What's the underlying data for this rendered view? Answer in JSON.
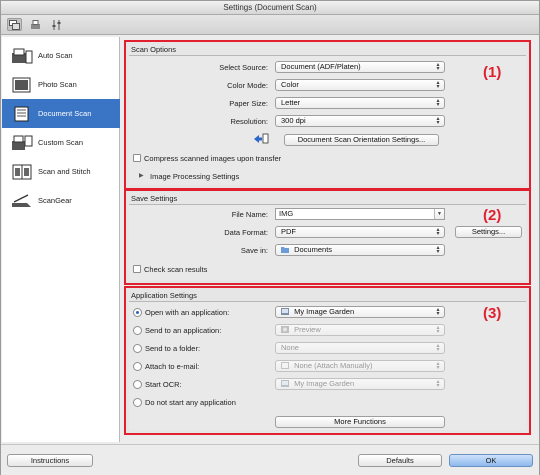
{
  "window": {
    "title": "Settings (Document Scan)"
  },
  "toolbar": {
    "icons": [
      "scan-from-computer-icon",
      "scan-from-panel-icon",
      "general-settings-icon"
    ]
  },
  "sidebar": {
    "items": [
      {
        "label": "Auto Scan",
        "icon": "auto-scan-icon"
      },
      {
        "label": "Photo Scan",
        "icon": "photo-scan-icon"
      },
      {
        "label": "Document Scan",
        "icon": "document-scan-icon",
        "active": true
      },
      {
        "label": "Custom Scan",
        "icon": "custom-scan-icon"
      },
      {
        "label": "Scan and Stitch",
        "icon": "scan-and-stitch-icon"
      },
      {
        "label": "ScanGear",
        "icon": "scangear-icon"
      }
    ]
  },
  "scan_options": {
    "title": "Scan Options",
    "marker": "(1)",
    "source_label": "Select Source:",
    "source_value": "Document (ADF/Platen)",
    "color_label": "Color Mode:",
    "color_value": "Color",
    "paper_label": "Paper Size:",
    "paper_value": "Letter",
    "resolution_label": "Resolution:",
    "resolution_value": "300 dpi",
    "orientation_button": "Document Scan Orientation Settings...",
    "compress_label": "Compress scanned images upon transfer",
    "image_processing_label": "Image Processing Settings"
  },
  "save_settings": {
    "title": "Save Settings",
    "marker": "(2)",
    "filename_label": "File Name:",
    "filename_value": "IMG",
    "format_label": "Data Format:",
    "format_value": "PDF",
    "settings_button": "Settings...",
    "savein_label": "Save in:",
    "savein_value": "Documents",
    "check_results_label": "Check scan results"
  },
  "application_settings": {
    "title": "Application Settings",
    "marker": "(3)",
    "options": [
      {
        "label": "Open with an application:",
        "value": "My Image Garden",
        "selected": true,
        "enabled": true
      },
      {
        "label": "Send to an application:",
        "value": "Preview",
        "selected": false,
        "enabled": false
      },
      {
        "label": "Send to a folder:",
        "value": "None",
        "selected": false,
        "enabled": false
      },
      {
        "label": "Attach to e-mail:",
        "value": "None (Attach Manually)",
        "selected": false,
        "enabled": false
      },
      {
        "label": "Start OCR:",
        "value": "My Image Garden",
        "selected": false,
        "enabled": false
      },
      {
        "label": "Do not start any application",
        "selected": false
      }
    ],
    "more_button": "More Functions"
  },
  "footer": {
    "instructions_button": "Instructions",
    "defaults_button": "Defaults",
    "ok_button": "OK"
  }
}
